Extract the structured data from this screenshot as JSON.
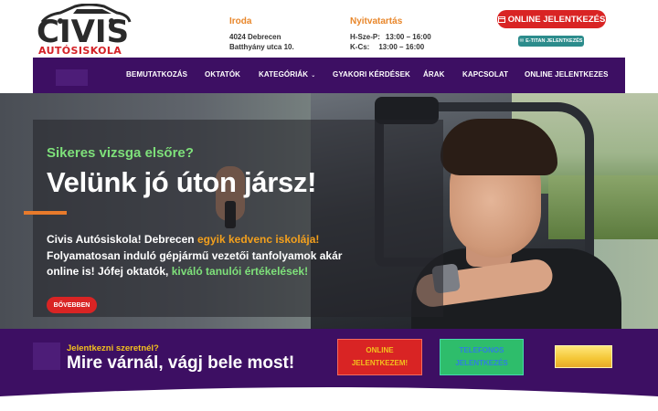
{
  "brand": {
    "name": "CIVIS",
    "subtitle": "AUTÓSISKOLA"
  },
  "header": {
    "address": {
      "title": "Iroda",
      "line1": "4024 Debrecen",
      "line2": "Batthyány utca 10."
    },
    "hours": {
      "title": "Nyitvatartás",
      "rows": [
        {
          "days": "H-Sze-P:",
          "time": "13:00 – 16:00"
        },
        {
          "days": "K-Cs:",
          "time": "13:00 – 16:00"
        }
      ]
    },
    "online_button": "ONLINE JELENTKEZÉS",
    "etitan_button": "E-TITAN JELENTKEZÉS"
  },
  "nav": {
    "items": [
      {
        "label": "BEMUTATKOZÁS"
      },
      {
        "label": "OKTATÓK"
      },
      {
        "label": "KATEGÓRIÁK"
      },
      {
        "label": "GYAKORI KÉRDÉSEK"
      },
      {
        "label": "ÁRAK"
      },
      {
        "label": "KAPCSOLAT"
      },
      {
        "label": "ONLINE JELENTKEZES"
      }
    ]
  },
  "hero": {
    "kicker": "Sikeres vizsga elsőre?",
    "title": "Velünk jó úton jársz!",
    "text_parts": {
      "p1": "Civis Autósiskola! Debrecen ",
      "p2": "egyik kedvenc iskolája!",
      "p3": " Folyamatosan induló gépjármű vezetői tanfolyamok akár online is! Jófej oktatók, ",
      "p4": "kiváló tanulói értékelések!"
    },
    "more_button": "BŐVEBBEN"
  },
  "cta": {
    "kicker": "Jelentkezni szeretnél?",
    "title": "Mire várnál, vágj bele most!",
    "online_button": "ONLINE JELENTKEZEM!",
    "phone_button": "TELEFONOS JELENTKEZÉS"
  },
  "colors": {
    "purple": "#3d0f63",
    "red": "#d92424",
    "orange": "#e87a2b",
    "green": "#7ee07a",
    "teal": "#2c8c8c"
  }
}
